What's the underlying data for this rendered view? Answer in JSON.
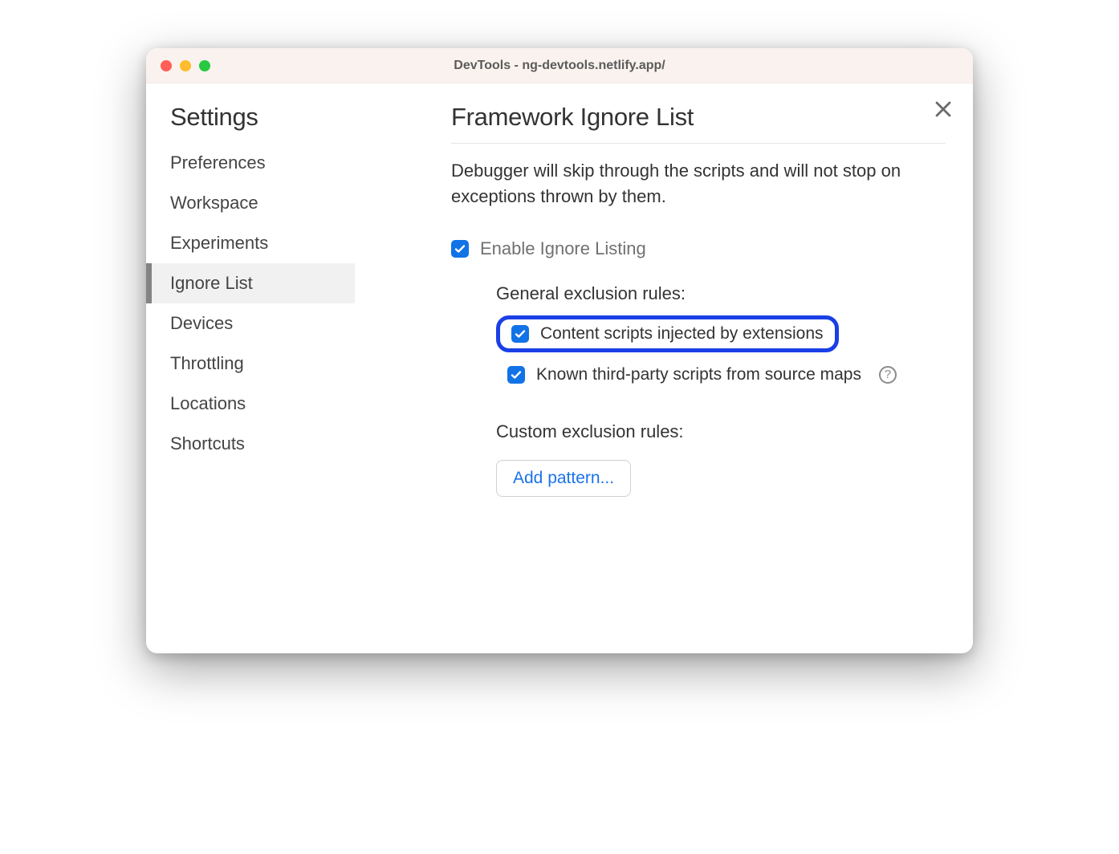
{
  "titlebar": {
    "title": "DevTools - ng-devtools.netlify.app/"
  },
  "sidebar": {
    "title": "Settings",
    "items": [
      {
        "label": "Preferences",
        "selected": false
      },
      {
        "label": "Workspace",
        "selected": false
      },
      {
        "label": "Experiments",
        "selected": false
      },
      {
        "label": "Ignore List",
        "selected": true
      },
      {
        "label": "Devices",
        "selected": false
      },
      {
        "label": "Throttling",
        "selected": false
      },
      {
        "label": "Locations",
        "selected": false
      },
      {
        "label": "Shortcuts",
        "selected": false
      }
    ]
  },
  "main": {
    "page_title": "Framework Ignore List",
    "description": "Debugger will skip through the scripts and will not stop on exceptions thrown by them.",
    "enable_label": "Enable Ignore Listing",
    "enable_checked": true,
    "general_rules_label": "General exclusion rules:",
    "rules": [
      {
        "label": "Content scripts injected by extensions",
        "checked": true,
        "highlight": true,
        "help": false
      },
      {
        "label": "Known third-party scripts from source maps",
        "checked": true,
        "highlight": false,
        "help": true
      }
    ],
    "custom_rules_label": "Custom exclusion rules:",
    "add_pattern_label": "Add pattern..."
  },
  "colors": {
    "checkbox_bg": "#1173e6",
    "highlight_border": "#1a3fe6",
    "link": "#1a73e8"
  }
}
